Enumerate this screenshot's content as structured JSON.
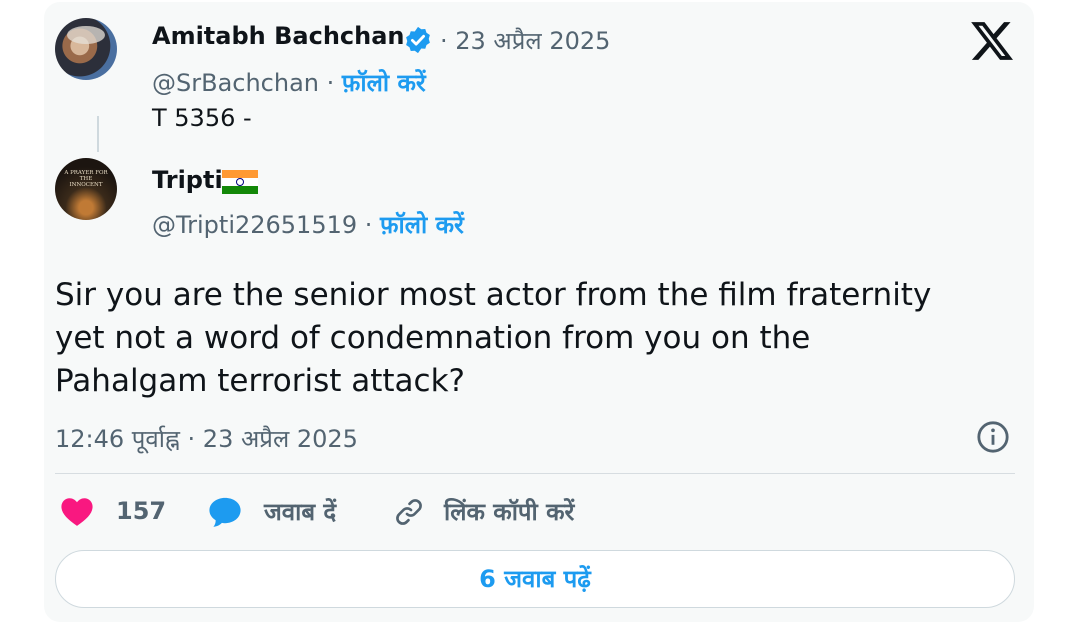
{
  "original_tweet": {
    "author_name": "Amitabh Bachchan",
    "date": "· 23 अप्रैल 2025",
    "handle": "@SrBachchan",
    "separator": " · ",
    "follow_label": "फ़ॉलो करें",
    "text": "T 5356 -",
    "verified_color": "#1d9bf0"
  },
  "reply_tweet": {
    "author_name": "Tripti",
    "handle": "@Tripti22651519",
    "separator": " · ",
    "follow_label": "फ़ॉलो करें",
    "avatar_text": "A PRAYER FOR THE INNOCENT",
    "text_line1": "Sir you are the senior most actor from the film fraternity",
    "text_line2": "yet not a word of condemnation from you on the",
    "text_line3": "Pahalgam terrorist attack?",
    "timestamp": "12:46 पूर्वाह्न · 23 अप्रैल 2025"
  },
  "actions": {
    "like_count": "157",
    "reply_label": "जवाब दें",
    "copy_link_label": "लिंक कॉपी करें"
  },
  "read_replies_label": "6 जवाब पढ़ें",
  "colors": {
    "accent": "#1d9bf0",
    "like": "#f91880",
    "secondary_text": "#536471",
    "background": "#f7f9f9"
  }
}
